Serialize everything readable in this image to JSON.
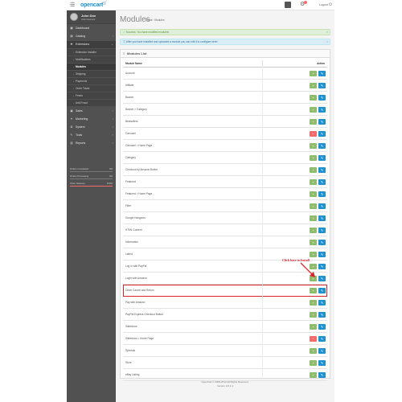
{
  "header": {
    "menu_icon": "bars-icon",
    "logo_text": "opencart",
    "logo_cart": "🛒",
    "bell_glyph": "⚙",
    "logout": "Logout",
    "logout_glyph": "⏻"
  },
  "profile": {
    "name": "John Doe",
    "role": "Administrator"
  },
  "nav": [
    {
      "icon": "dashboard-icon",
      "glyph": "▦",
      "label": "Dashboard",
      "caret": ""
    },
    {
      "icon": "tag-icon",
      "glyph": "▤",
      "label": "Catalog",
      "caret": "›"
    },
    {
      "icon": "puzzle-icon",
      "glyph": "✚",
      "label": "Extensions",
      "caret": "⌄",
      "active": true
    }
  ],
  "subnav": [
    {
      "label": "Extension Installer"
    },
    {
      "label": "Modifications"
    },
    {
      "label": "Modules",
      "current": true
    },
    {
      "label": "Shipping"
    },
    {
      "label": "Payments"
    },
    {
      "label": "Order Totals"
    },
    {
      "label": "Feeds"
    },
    {
      "label": "Anti-Fraud"
    }
  ],
  "nav2": [
    {
      "icon": "cart-icon",
      "glyph": "▣",
      "label": "Sales",
      "caret": "›"
    },
    {
      "icon": "share-icon",
      "glyph": "✦",
      "label": "Marketing",
      "caret": "›"
    },
    {
      "icon": "cog-icon",
      "glyph": "⚙",
      "label": "System",
      "caret": "›"
    },
    {
      "icon": "wrench-icon",
      "glyph": "✎",
      "label": "Tools",
      "caret": "›"
    },
    {
      "icon": "chart-icon",
      "glyph": "▥",
      "label": "Reports",
      "caret": "›"
    }
  ],
  "stats": [
    {
      "label": "Orders Completed",
      "percent": "0%",
      "value": 0,
      "color": "#23a1d1"
    },
    {
      "label": "Orders Processing",
      "percent": "0%",
      "value": 0,
      "color": "#8fbb6c"
    },
    {
      "label": "Other Statuses",
      "percent": "100%",
      "value": 100,
      "color": "#f56b6b"
    }
  ],
  "page": {
    "title": "Modules",
    "breadcrumb_home": "Home",
    "breadcrumb_sep": " › ",
    "breadcrumb_current": "Modules",
    "alert_success": "✓ Success: You have modified modules!",
    "alert_info": "ⓘ After you have installed and uploaded a module you can edit it to configure here!",
    "alert_close": "×",
    "panel_title": "Modules List",
    "panel_icon": "≡",
    "col_name": "Module Name",
    "col_action": "Action"
  },
  "modules": [
    {
      "name": "Account",
      "state": "installed"
    },
    {
      "name": "Affiliate",
      "state": "installed"
    },
    {
      "name": "Banner",
      "state": "installed"
    },
    {
      "name": "Banner > Category",
      "state": "installed"
    },
    {
      "name": "Bestsellers",
      "state": "installed"
    },
    {
      "name": "Carousel",
      "state": "uninstalled"
    },
    {
      "name": "Carousel > Home Page",
      "state": "installed"
    },
    {
      "name": "Category",
      "state": "installed"
    },
    {
      "name": "Checkout by Amazon Button",
      "state": "installed"
    },
    {
      "name": "Featured",
      "state": "installed"
    },
    {
      "name": "Featured > Home Page",
      "state": "installed"
    },
    {
      "name": "Filter",
      "state": "installed"
    },
    {
      "name": "Google Hangouts",
      "state": "installed"
    },
    {
      "name": "HTML Content",
      "state": "installed"
    },
    {
      "name": "Information",
      "state": "installed"
    },
    {
      "name": "Latest",
      "state": "installed"
    },
    {
      "name": "Log in with PayPal",
      "state": "installed"
    },
    {
      "name": "Login with Amazon",
      "state": "installed"
    },
    {
      "name": "Order Cancel and Return",
      "state": "installed",
      "highlight": true
    },
    {
      "name": "Pay with Amazon",
      "state": "installed"
    },
    {
      "name": "PayPal Express Checkout Button",
      "state": "installed"
    },
    {
      "name": "Slideshow",
      "state": "installed"
    },
    {
      "name": "Slideshow > Home Page",
      "state": "uninstalled"
    },
    {
      "name": "Specials",
      "state": "installed"
    },
    {
      "name": "Store",
      "state": "installed"
    },
    {
      "name": "eBay Listing",
      "state": "installed"
    }
  ],
  "buttons": {
    "install_glyph": "+",
    "uninstall_glyph": "−",
    "edit_glyph": "✎",
    "install_color": "#8fbb6c",
    "uninstall_color": "#f56b6b",
    "edit_color": "#1e91cf"
  },
  "callout": {
    "text": "Click here to Install"
  },
  "footer": {
    "text": "OpenCart © 2009-2014 All Rights Reserved.",
    "version": "Version 2.0.1.1"
  }
}
